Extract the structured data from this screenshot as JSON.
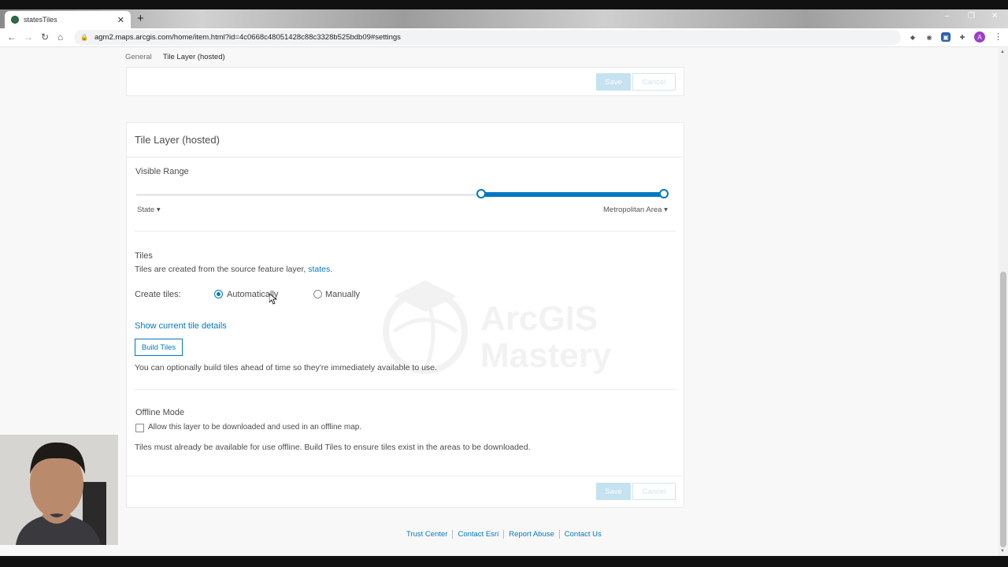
{
  "browser": {
    "tab_title": "statesTiles",
    "tab_close": "✕",
    "new_tab": "+",
    "url": "agm2.maps.arcgis.com/home/item.html?id=4c0668c48051428c88c3328b525bdb09#settings",
    "avatar_letter": "A",
    "window_controls": [
      "–",
      "❐",
      "✕"
    ],
    "nav": {
      "back": "←",
      "forward": "→",
      "reload": "↻",
      "home": "⌂"
    },
    "menu": "⋮",
    "lock": "🔒"
  },
  "subnav": {
    "general": "General",
    "tile_layer": "Tile Layer (hosted)"
  },
  "top_actions": {
    "save": "Save",
    "cancel": "Cancel"
  },
  "tile_card": {
    "title": "Tile Layer (hosted)",
    "visible_range": {
      "label": "Visible Range",
      "min_label": "State",
      "max_label": "Metropolitan Area",
      "min_position": 0.653,
      "max_position": 1.0
    },
    "tiles": {
      "heading": "Tiles",
      "description_prefix": "Tiles are created from the source feature layer, ",
      "source_link": "states",
      "description_suffix": ".",
      "create_label": "Create tiles:",
      "option_auto": "Automatically",
      "option_manual": "Manually",
      "selected": "Automatically",
      "details_link": "Show current tile details",
      "build_button": "Build Tiles",
      "build_note": "You can optionally build tiles ahead of time so they're immediately available to use."
    },
    "offline": {
      "heading": "Offline Mode",
      "checkbox_label": "Allow this layer to be downloaded and used in an offline map.",
      "checked": false,
      "note": "Tiles must already be available for use offline. Build Tiles to ensure tiles exist in the areas to be downloaded."
    },
    "actions": {
      "save": "Save",
      "cancel": "Cancel"
    }
  },
  "watermark": {
    "line1": "ArcGIS",
    "line2": "Mastery"
  },
  "footer": [
    "Trust Center",
    "Contact Esri",
    "Report Abuse",
    "Contact Us"
  ],
  "colors": {
    "accent": "#0079c1",
    "disabled_button": "#c5e2f1",
    "text": "#4c4c4c"
  }
}
